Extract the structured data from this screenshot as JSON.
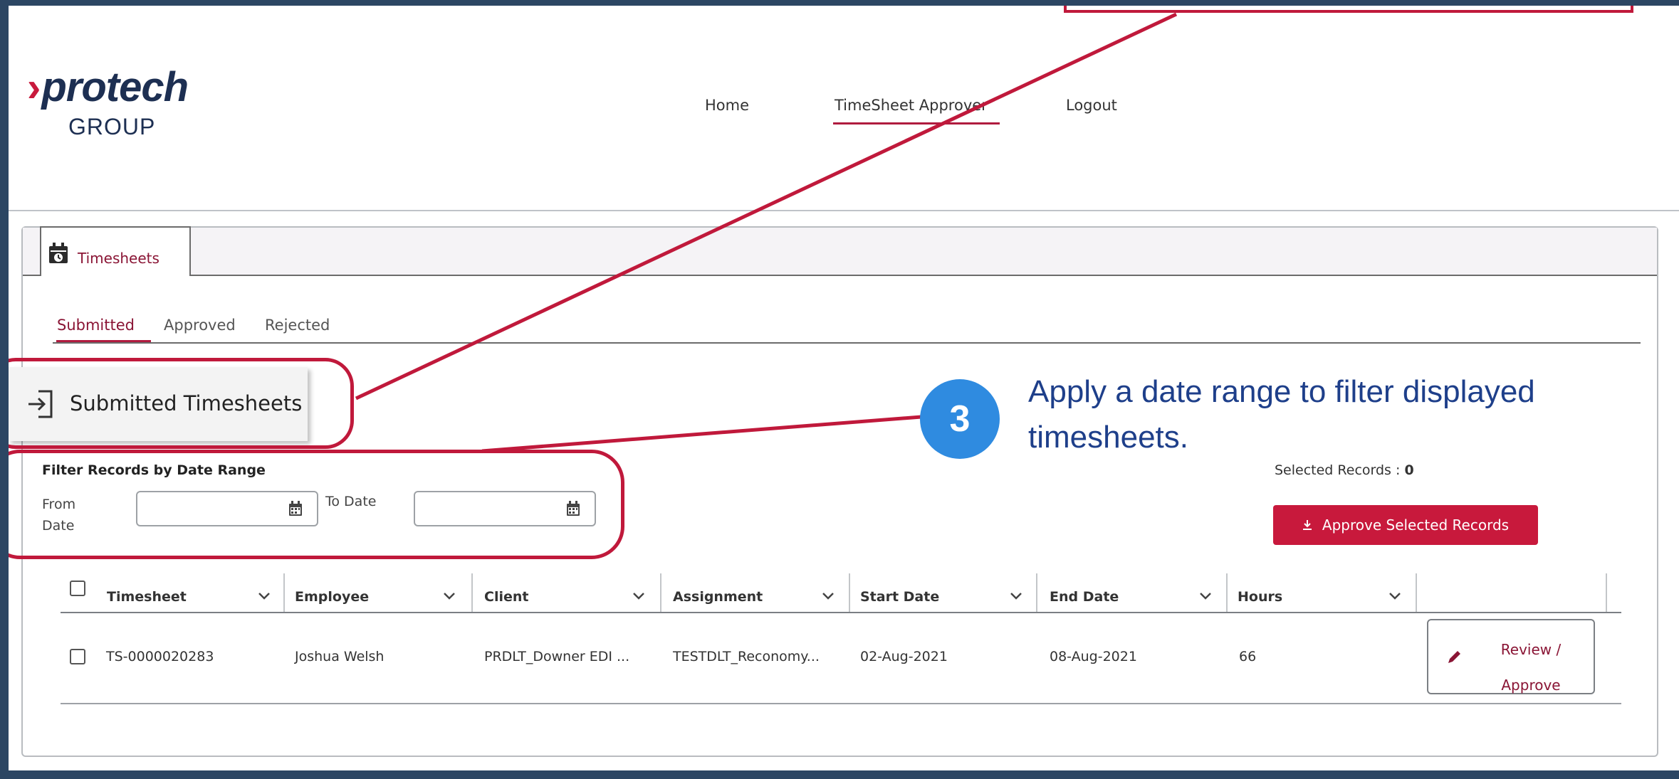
{
  "header": {
    "logo_text": "protech",
    "logo_sub": "GROUP",
    "nav": [
      {
        "label": "Home"
      },
      {
        "label": "TimeSheet Approver"
      },
      {
        "label": "Logout"
      }
    ]
  },
  "panel": {
    "tab_label": "Timesheets",
    "sub_tabs": [
      "Submitted",
      "Approved",
      "Rejected"
    ],
    "section_label": "Submitted Timesheets"
  },
  "filter": {
    "title": "Filter Records by Date Range",
    "from_label": "From Date",
    "to_label": "To Date",
    "from_value": "",
    "to_value": ""
  },
  "selection": {
    "selected_text": "Selected Records : ",
    "selected_count": "0",
    "approve_button": "Approve Selected Records"
  },
  "callout": {
    "number": "3",
    "text": "Apply a date range to filter displayed timesheets."
  },
  "table": {
    "columns": [
      "Timesheet",
      "Employee",
      "Client",
      "Assignment",
      "Start Date",
      "End Date",
      "Hours"
    ],
    "rows": [
      {
        "timesheet": "TS-0000020283",
        "employee": "Joshua Welsh",
        "client": "PRDLT_Downer EDI ...",
        "assignment": "TESTDLT_Reconomy...",
        "start_date": "02-Aug-2021",
        "end_date": "08-Aug-2021",
        "hours": "66",
        "action_line1": "Review /",
        "action_line2": "Approve"
      }
    ]
  },
  "colors": {
    "brand": "#c8193c",
    "callout_blue": "#2f8be0",
    "callout_text": "#1e3f8a",
    "frame": "#2c4663"
  }
}
